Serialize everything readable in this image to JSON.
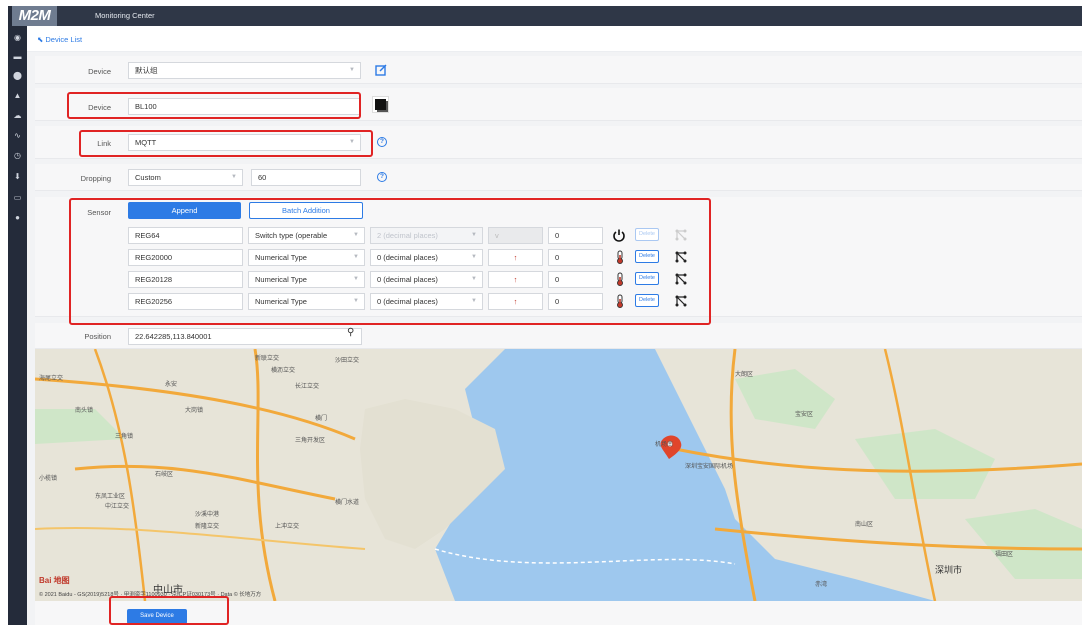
{
  "app": {
    "logo": "M2M",
    "title": "Monitoring Center"
  },
  "sidebar_icons": [
    "eye-icon",
    "message-icon",
    "location-pin-icon",
    "bell-icon",
    "cloud-icon",
    "chart-icon",
    "clock-icon",
    "download-icon",
    "card-icon",
    "user-icon"
  ],
  "breadcrumb": {
    "back_label": "Device List"
  },
  "form": {
    "group": {
      "label": "Device",
      "value": "默认组"
    },
    "device": {
      "label": "Device",
      "value": "BL100"
    },
    "link": {
      "label": "Link",
      "value": "MQTT"
    },
    "dropping": {
      "label": "Dropping",
      "mode": "Custom",
      "value": "60"
    },
    "sensor": {
      "label": "Sensor",
      "append_label": "Append",
      "batch_label": "Batch Addition",
      "delete_label": "Delete",
      "rows": [
        {
          "name": "REG64",
          "type": "Switch type (operable",
          "decimals": "2 (decimal places)",
          "unit": "v",
          "value": "0",
          "icon": "power-icon",
          "disabled": true
        },
        {
          "name": "REG20000",
          "type": "Numerical Type",
          "decimals": "0 (decimal places)",
          "unit": "↑",
          "value": "0",
          "icon": "thermometer-icon",
          "disabled": false
        },
        {
          "name": "REG20128",
          "type": "Numerical Type",
          "decimals": "0 (decimal places)",
          "unit": "↑",
          "value": "0",
          "icon": "thermometer-icon",
          "disabled": false
        },
        {
          "name": "REG20256",
          "type": "Numerical Type",
          "decimals": "0 (decimal places)",
          "unit": "↑",
          "value": "0",
          "icon": "thermometer-icon",
          "disabled": false
        }
      ]
    },
    "position": {
      "label": "Position",
      "value": "22.642285,113.840001"
    }
  },
  "map": {
    "labels": [
      "新联立交",
      "横沥立交",
      "海尾立交",
      "南头镇",
      "大岗镇",
      "永安",
      "三角镇",
      "三角开发区",
      "石岐区",
      "中山市",
      "沙溪中港",
      "中江立交",
      "新隆立交",
      "东凤工业区",
      "上冲立交",
      "横门",
      "横门水道",
      "长江立交",
      "沙田立交",
      "深圳宝安国际机场",
      "机场南",
      "宝安区",
      "深圳市",
      "南山区",
      "福田区",
      "大朗区",
      "赤湾",
      "小榄镇"
    ],
    "copyright": "© 2021 Baidu - GS(2019)5218号 · 甲测资字1100930 · 京ICP证030173号 · Data © 长地万方",
    "logo": "Bai 地图"
  },
  "save_label": "Save Device"
}
